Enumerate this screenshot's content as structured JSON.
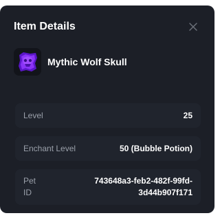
{
  "dialog": {
    "title": "Item Details",
    "close_icon": "close-icon"
  },
  "item": {
    "name": "Mythic Wolf Skull",
    "thumbnail_icon": "item-thumbnail",
    "accent_color": "#7b2cf5"
  },
  "details": {
    "level": {
      "label": "Level",
      "value": "25"
    },
    "enchant_level": {
      "label": "Enchant Level",
      "value": "50 (Bubble Potion)"
    },
    "pet_id": {
      "label_line1": "Pet",
      "label_line2": "ID",
      "value_line1": "743648a3-feb2-482f-99fd-",
      "value_line2": "3d44b907f171"
    }
  }
}
